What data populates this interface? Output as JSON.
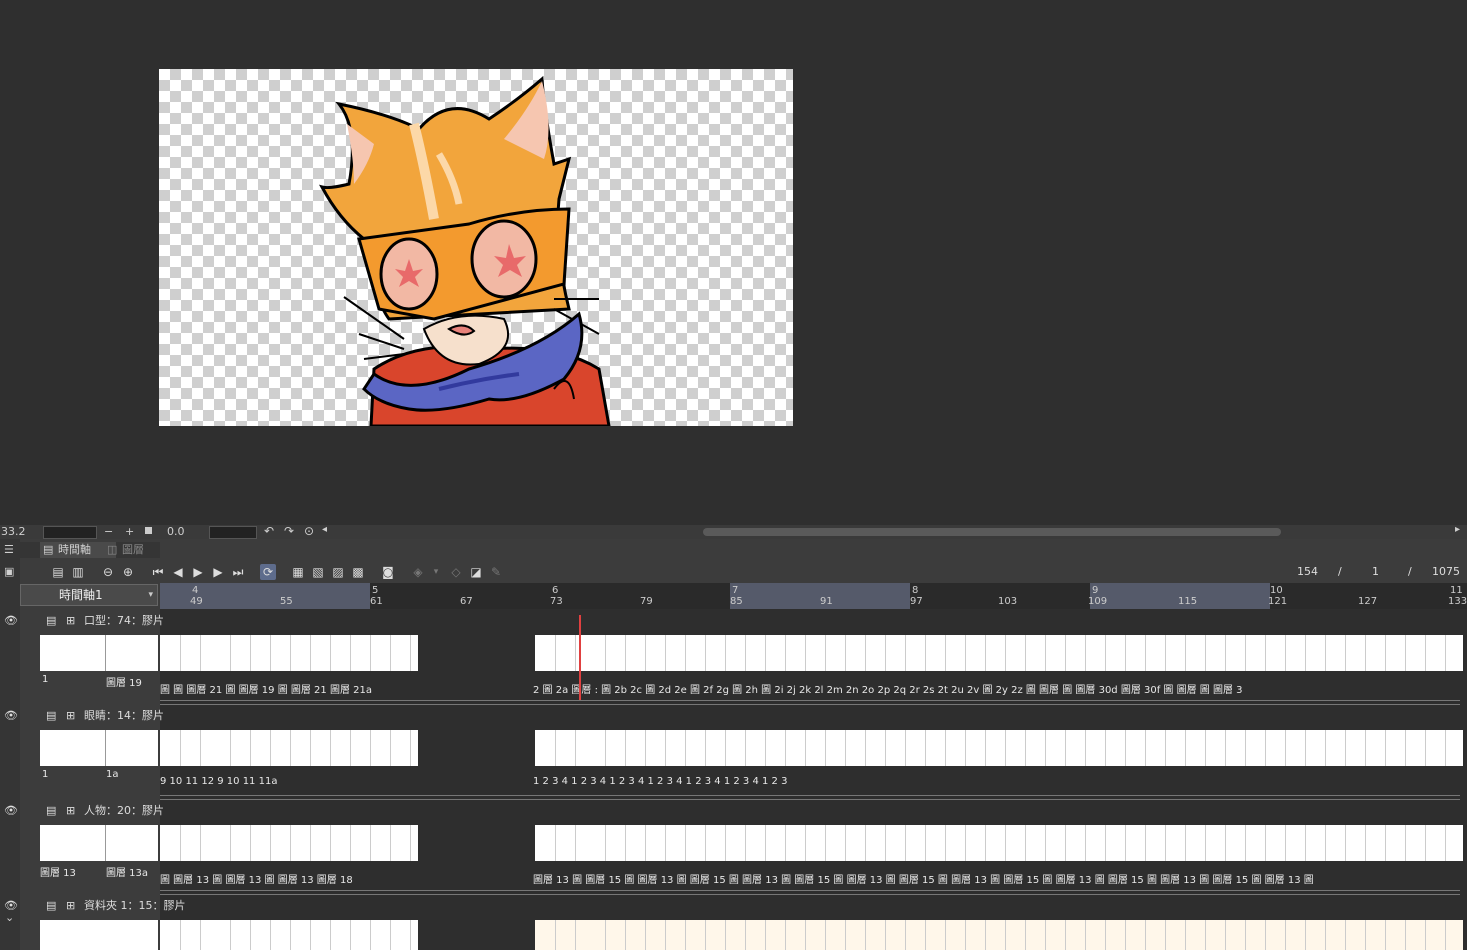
{
  "canvas": {
    "description_colors": {
      "bg": "#2f2f2f"
    }
  },
  "status": {
    "zoom": "33.2",
    "minus": "−",
    "plus": "+",
    "angle": "0.0"
  },
  "panel": {
    "tabs": [
      {
        "label": "時間軸"
      },
      {
        "label": "圖層"
      }
    ]
  },
  "toolbar": {
    "frame_current": "154",
    "sep1": "/",
    "frame_start": "1",
    "sep2": "/",
    "frame_total": "1075"
  },
  "timeline": {
    "name": "時間軸1"
  },
  "ruler": {
    "major": [
      {
        "label": "4"
      },
      {
        "label": "5"
      },
      {
        "label": "6"
      },
      {
        "label": "7"
      },
      {
        "label": "8"
      },
      {
        "label": "9"
      },
      {
        "label": "10"
      },
      {
        "label": "11"
      }
    ],
    "minor": [
      {
        "label": "49"
      },
      {
        "label": "55"
      },
      {
        "label": "61"
      },
      {
        "label": "67"
      },
      {
        "label": "73"
      },
      {
        "label": "79"
      },
      {
        "label": "85"
      },
      {
        "label": "91"
      },
      {
        "label": "97"
      },
      {
        "label": "103"
      },
      {
        "label": "109"
      },
      {
        "label": "115"
      },
      {
        "label": "121"
      },
      {
        "label": "127"
      },
      {
        "label": "133"
      }
    ]
  },
  "layers": [
    {
      "name": "口型：74：膠片",
      "left_label1": "1",
      "left_label2": "圖層 19",
      "labels_a": "圖 圖 圖層 21 圖 圖層 19 圖 圖層 21 圖層 21a",
      "labels_b": "2   圖 2a 圖層 : 圖 2b 2c   圖 2d 2e   圖 2f 2g 圖 2h 圖 2i   2j 2k 2l 2m   2n 2o 2p 2q 2r 2s   2t 2u 2v   圖 2y   2z 圖 圖層 圖 圖層 30d 圖層 30f 圖 圖層 圖 圖層 3"
    },
    {
      "name": "眼睛：14：膠片",
      "left_label1": "1",
      "left_label2": "1a",
      "labels_a": "9  10 11     12 9      10 11    11a",
      "labels_b": "1        2   3        4   1        2   3        4   1        2   3        4   1        2   3        4   1        2   3        4   1        2   3        4   1        2   3"
    },
    {
      "name": "人物：20：膠片",
      "left_label1": "圖層 13",
      "left_label2": "圖層 13a",
      "labels_a": "圖 圖層 13 圖 圖層 13 圖 圖層 13 圖層 18",
      "labels_b": "圖層 13 圖 圖層 15 圖 圖層 13 圖 圖層 15 圖 圖層 13 圖 圖層 15 圖 圖層 13 圖 圖層 15 圖 圖層 13 圖 圖層 15 圖 圖層 13 圖 圖層 15 圖 圖層 13 圖 圖層 15 圖 圖層 13 圖"
    },
    {
      "name": "資料夾 1：15：膠片",
      "left_label1": "",
      "left_label2": "",
      "labels_a": "",
      "labels_b": ""
    }
  ]
}
